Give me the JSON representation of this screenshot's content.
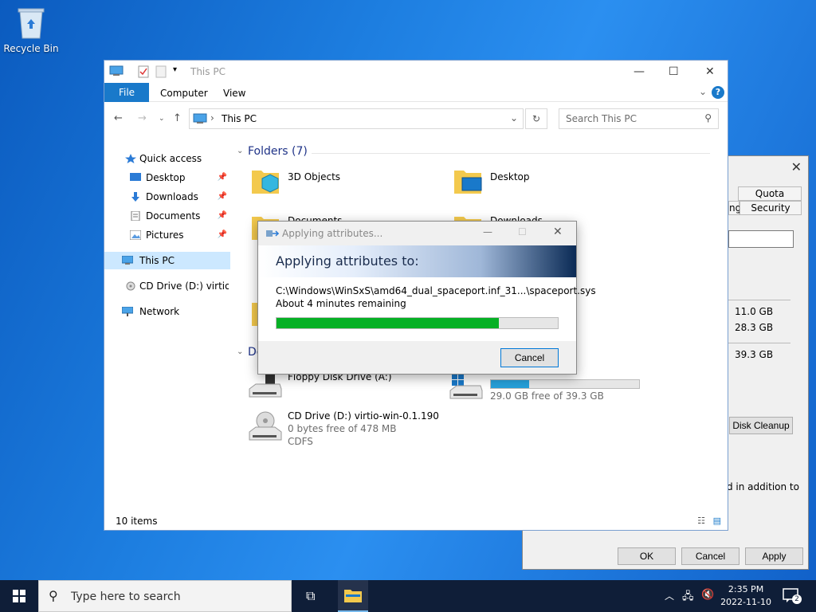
{
  "desktop": {
    "recycle_label": "Recycle Bin"
  },
  "explorer": {
    "title": "This PC",
    "ribbon_tabs": {
      "file": "File",
      "computer": "Computer",
      "view": "View"
    },
    "address": "This PC",
    "search_placeholder": "Search This PC",
    "sidebar": {
      "quick_access": "Quick access",
      "desktop": "Desktop",
      "downloads": "Downloads",
      "documents": "Documents",
      "pictures": "Pictures",
      "this_pc": "This PC",
      "cd_drive": "CD Drive (D:) virtio-w",
      "network": "Network"
    },
    "folders_header": "Folders (7)",
    "folders": {
      "f1": "3D Objects",
      "f2": "Desktop",
      "f3": "Documents",
      "f4": "Downloads"
    },
    "devices_header_partial": "De",
    "devices": {
      "floppy": "Floppy Disk Drive (A:)",
      "c_free": "29.0 GB free of 39.3 GB",
      "cd_name": "CD Drive (D:) virtio-win-0.1.190",
      "cd_free": "0 bytes free of 478 MB",
      "cd_fs": "CDFS"
    },
    "c_used_fraction": 0.26,
    "status_items": "10 items"
  },
  "properties": {
    "tab_quota": "Quota",
    "tab_partial": "ng",
    "tab_security": "Security",
    "used": "11.0 GB",
    "free": "28.3 GB",
    "capacity": "39.3 GB",
    "disk_cleanup": "Disk Cleanup",
    "note": "d in addition to",
    "ok": "OK",
    "cancel": "Cancel",
    "apply": "Apply"
  },
  "progress_dialog": {
    "title": "Applying attributes...",
    "heading": "Applying attributes to:",
    "path": "C:\\Windows\\WinSxS\\amd64_dual_spaceport.inf_31...\\spaceport.sys",
    "remaining": "About 4 minutes remaining",
    "progress_fraction": 0.79,
    "cancel": "Cancel"
  },
  "taskbar": {
    "search_placeholder": "Type here to search",
    "time": "2:35 PM",
    "date": "2022-11-10",
    "notif_count": "2"
  },
  "colors": {
    "accent": "#1979ca",
    "progress": "#06b025",
    "taskbar": "#0f1e38"
  }
}
